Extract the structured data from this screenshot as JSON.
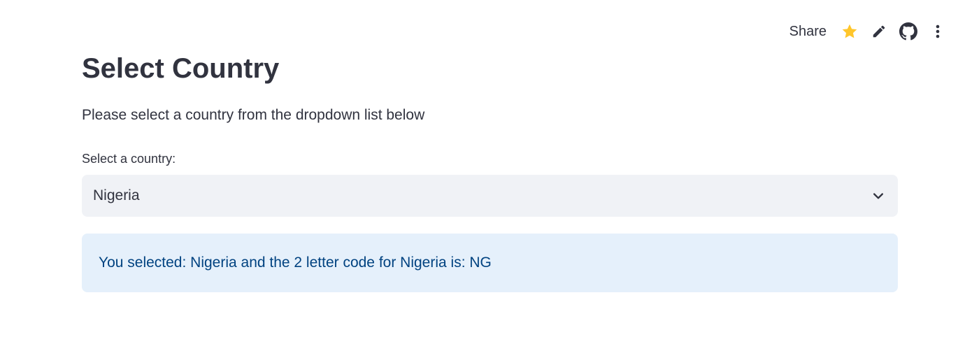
{
  "toolbar": {
    "share_label": "Share",
    "icons": [
      "star-icon",
      "edit-icon",
      "github-icon",
      "more-vert-icon"
    ],
    "star_color": "#ffc62b"
  },
  "main": {
    "title": "Select Country",
    "subtitle": "Please select a country from the dropdown list below",
    "select_label": "Select a country:",
    "selected_value": "Nigeria",
    "info_message": "You selected: Nigeria and the 2 letter code for Nigeria is: NG"
  },
  "colors": {
    "text": "#31333f",
    "select_bg": "#f0f2f6",
    "info_bg": "#e5f0fb",
    "info_text": "#004280"
  }
}
